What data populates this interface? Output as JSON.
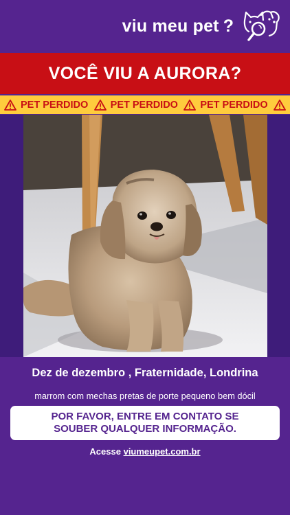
{
  "brand": {
    "name": "viu meu pet",
    "question_mark": "?",
    "logo_icon": "dog-cat-magnifier-icon"
  },
  "banner": {
    "title": "VOCÊ VIU A AURORA?"
  },
  "warning_strip": {
    "items": [
      {
        "icon": "warning-icon",
        "label": "PET PERDIDO"
      },
      {
        "icon": "warning-icon",
        "label": "PET PERDIDO"
      },
      {
        "icon": "warning-icon",
        "label": "PET PERDIDO"
      }
    ],
    "trailing_icon": "warning-icon"
  },
  "photo": {
    "subject": "dog-photo"
  },
  "details": {
    "location": "Dez de dezembro , Fraternidade, Londrina",
    "description": "marrom com mechas pretas de porte pequeno bem dócil"
  },
  "cta": {
    "text": "POR FAVOR, ENTRE EM CONTATO SE SOUBER QUALQUER INFORMAÇÃO."
  },
  "footer": {
    "prefix": "Acesse",
    "link": "viumeupet.com.br"
  },
  "colors": {
    "background": "#55248f",
    "banner": "#c80f15",
    "warning_strip": "#ffcc3d",
    "cta_background": "#ffffff"
  }
}
